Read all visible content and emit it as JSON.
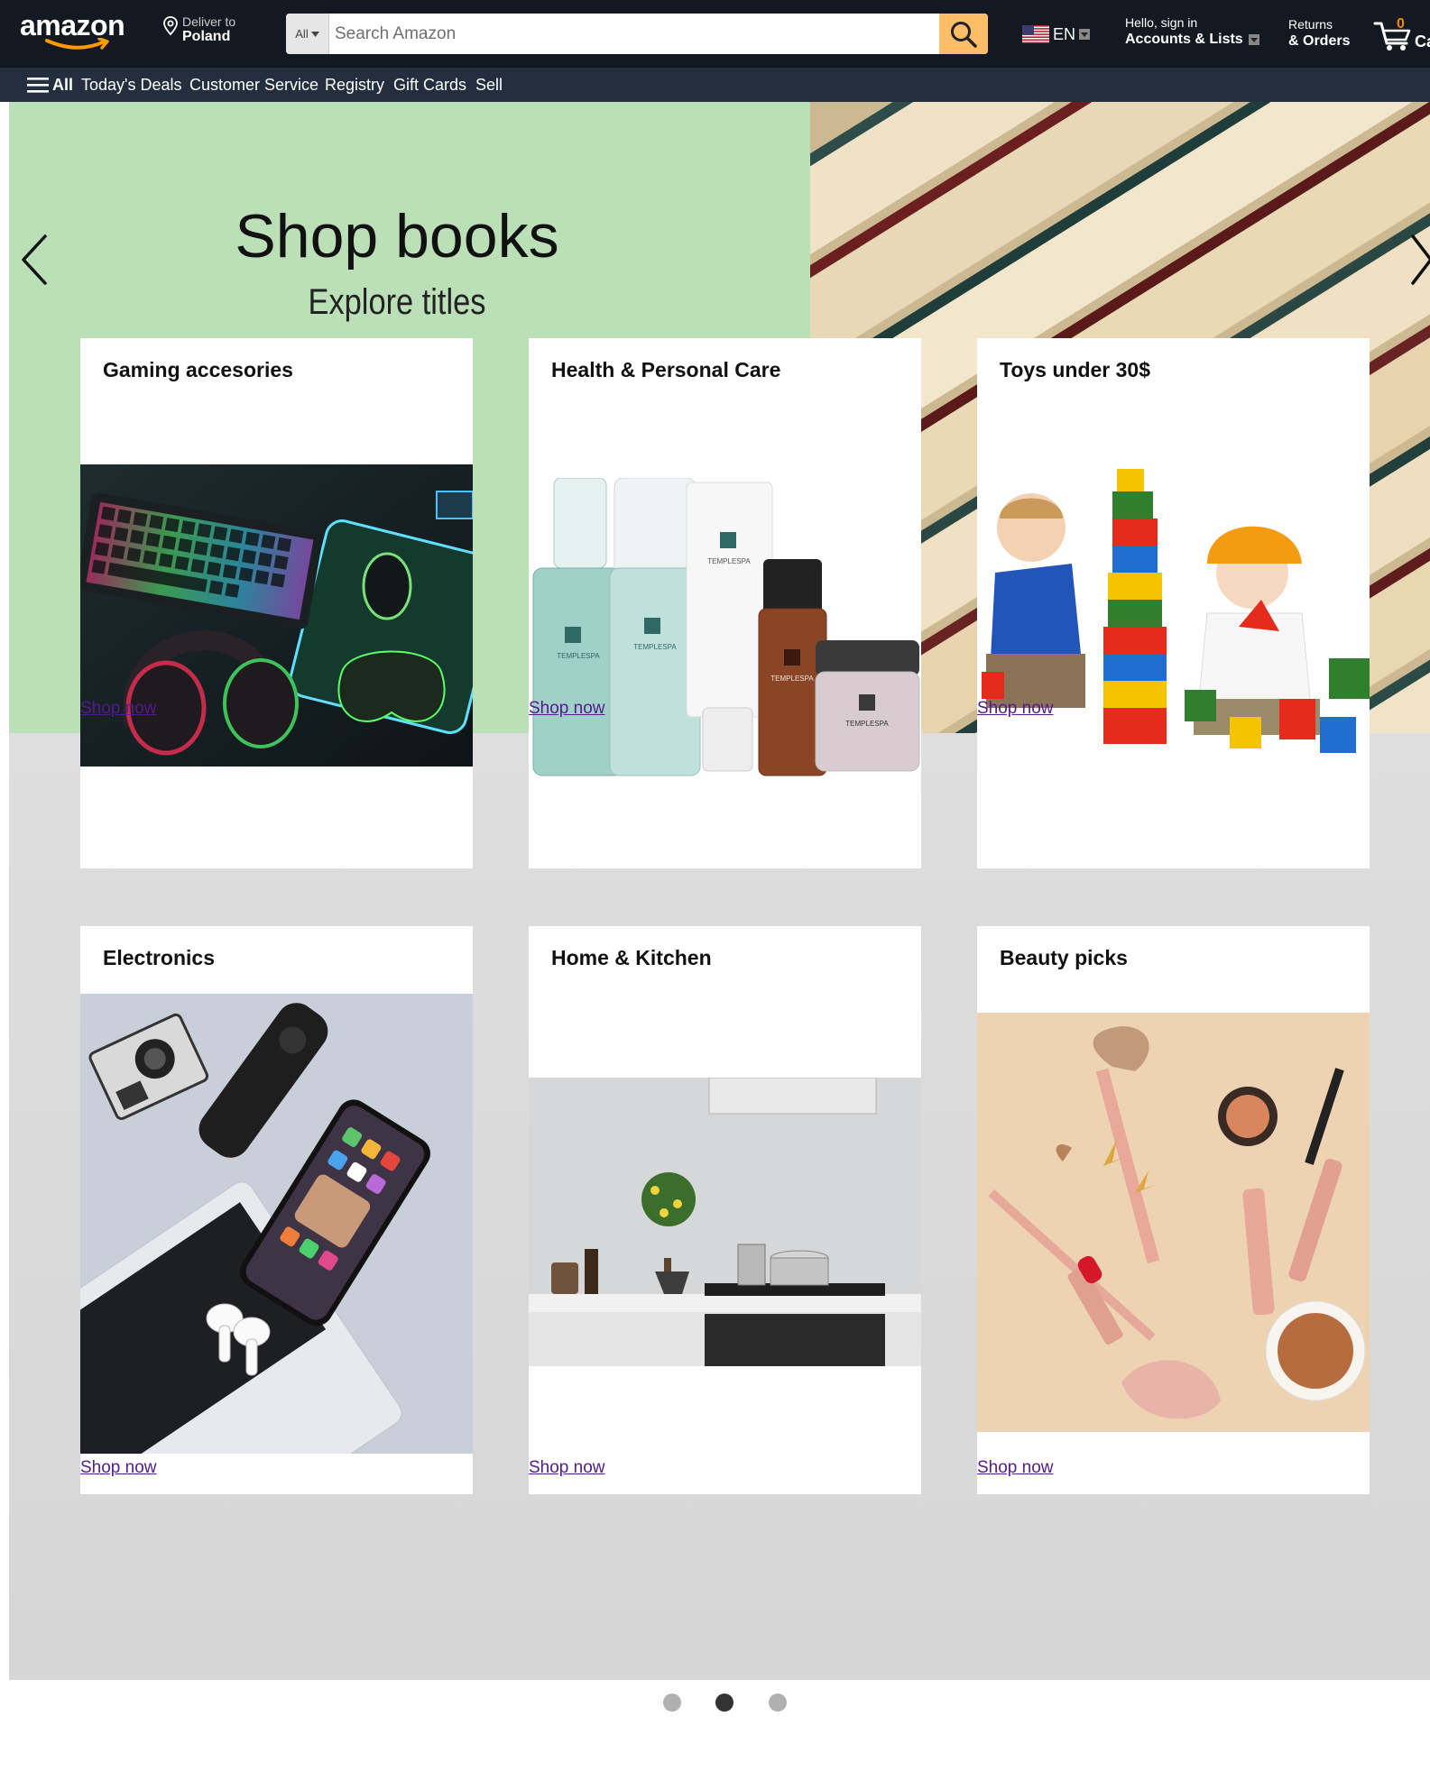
{
  "header": {
    "logo_text": "amazon",
    "deliver_to_label": "Deliver to",
    "deliver_to_location": "Poland",
    "search_category": "All",
    "search_placeholder": "Search Amazon",
    "language": "EN",
    "account_greeting": "Hello, sign in",
    "account_label": "Accounts & Lists",
    "returns_label": "Returns",
    "orders_label": "& Orders",
    "cart_count": "0",
    "cart_label": "Cart"
  },
  "nav": {
    "all_label": "All",
    "items": [
      "Today's Deals",
      "Customer Service",
      "Registry",
      "Gift Cards",
      "Sell"
    ]
  },
  "hero": {
    "title": "Shop books",
    "subtitle": "Explore titles",
    "active_slide": 2,
    "slide_count": 3
  },
  "cards": [
    {
      "title": "Gaming accesories",
      "link": "Shop now"
    },
    {
      "title": "Health & Personal Care",
      "link": "Shop now"
    },
    {
      "title": "Toys under 30$",
      "link": "Shop now"
    },
    {
      "title": "Electronics",
      "link": "Shop now"
    },
    {
      "title": "Home & Kitchen",
      "link": "Shop now"
    },
    {
      "title": "Beauty picks",
      "link": "Shop now"
    }
  ],
  "product_labels": {
    "brand": "TEMPLESPA"
  },
  "colors": {
    "header_bg": "#131921",
    "nav_bg": "#232f3e",
    "search_button": "#febd69",
    "cart_count": "#f08804",
    "hero_green": "#bbdfb6",
    "link": "#551a8b"
  }
}
